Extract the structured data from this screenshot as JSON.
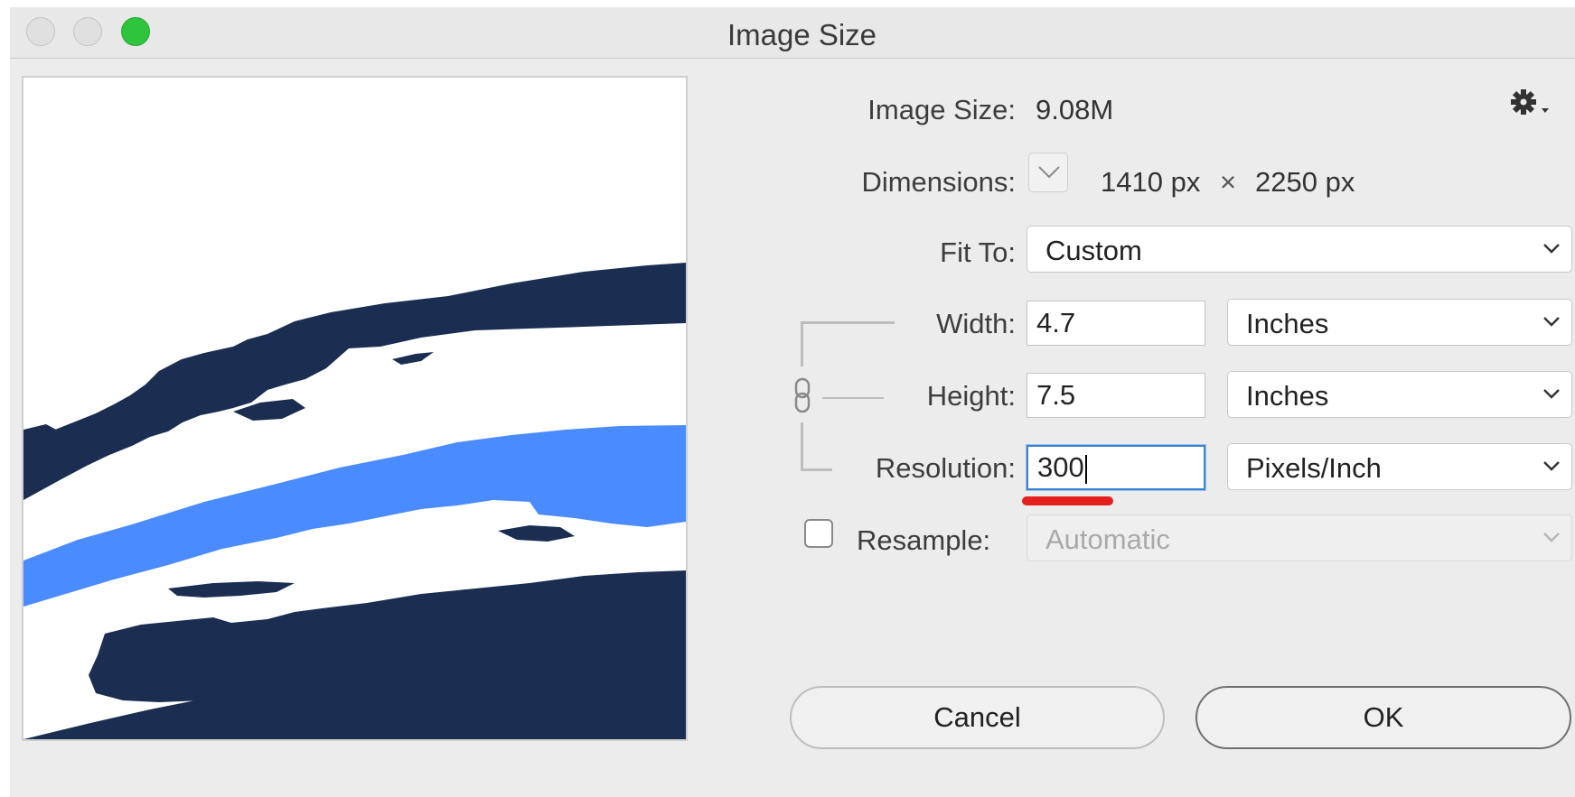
{
  "window": {
    "title": "Image Size"
  },
  "summary": {
    "image_size_label": "Image Size:",
    "image_size_value": "9.08M",
    "dimensions_label": "Dimensions:",
    "width_px": "1410 px",
    "times": "×",
    "height_px": "2250 px"
  },
  "fit_to": {
    "label": "Fit To:",
    "value": "Custom"
  },
  "width": {
    "label": "Width:",
    "value": "4.7",
    "unit": "Inches"
  },
  "height": {
    "label": "Height:",
    "value": "7.5",
    "unit": "Inches"
  },
  "resolution": {
    "label": "Resolution:",
    "value": "300",
    "unit": "Pixels/Inch"
  },
  "resample": {
    "label": "Resample:",
    "checked": false,
    "method": "Automatic"
  },
  "buttons": {
    "cancel": "Cancel",
    "ok": "OK"
  },
  "icons": [
    "gear-icon",
    "chevron-down-icon",
    "chain-link-icon"
  ],
  "colors": {
    "preview_dark": "#1b2e52",
    "preview_light": "#4a8cff",
    "focus_ring": "#3b82d6",
    "annotation": "#e4201f",
    "zoom_button": "#2ec43c"
  }
}
